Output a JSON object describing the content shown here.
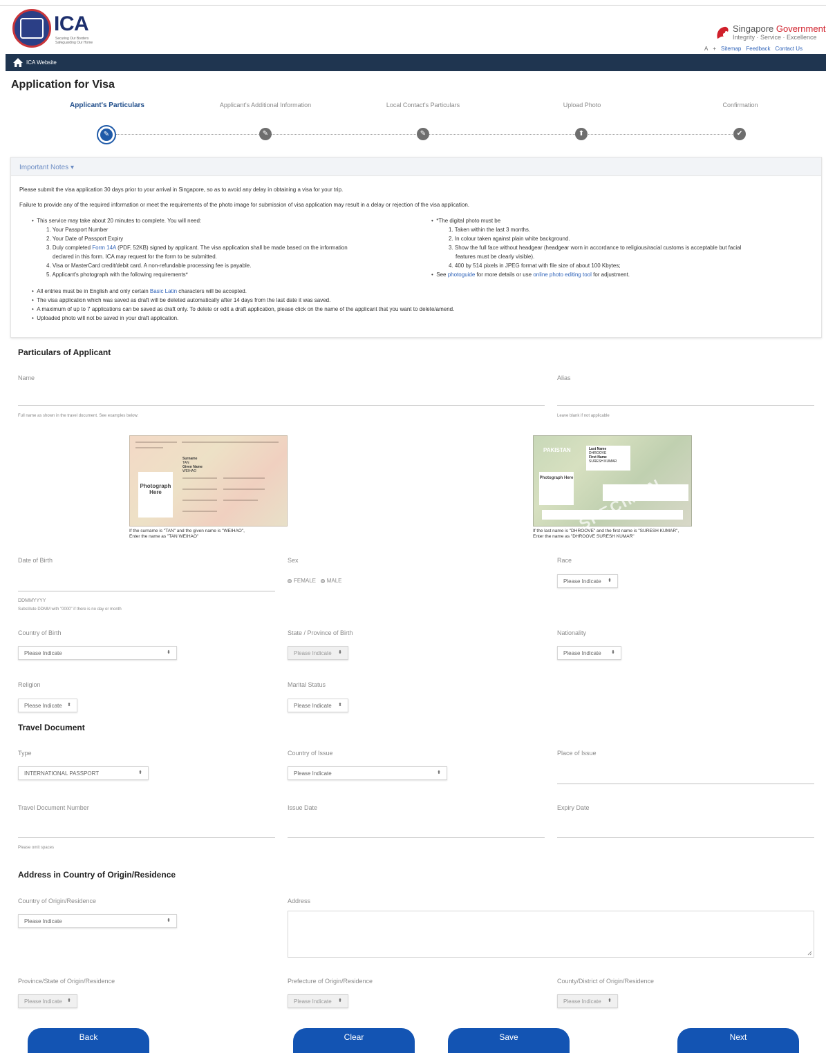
{
  "header": {
    "logo_text": "ICA",
    "logo_subtitle": "Securing Our Borders Safeguarding Our Home",
    "gov_name_part1": "Singapore",
    "gov_name_part2": "Government",
    "gov_motto": "Integrity · Service · Excellence",
    "font_small": "A",
    "font_large": "+",
    "sitemap": "Sitemap",
    "feedback": "Feedback",
    "contact": "Contact Us"
  },
  "nav": {
    "home_label": "ICA Website"
  },
  "page": {
    "title": "Application for Visa"
  },
  "steps": [
    {
      "label": "Applicant's Particulars"
    },
    {
      "label": "Applicant's Additional Information"
    },
    {
      "label": "Local Contact's Particulars"
    },
    {
      "label": "Upload Photo"
    },
    {
      "label": "Confirmation"
    }
  ],
  "notes": {
    "title": "Important Notes",
    "para1": "Please submit the visa application 30 days prior to your arrival in Singapore, so as to avoid any delay in obtaining a visa for your trip.",
    "para2": "Failure to provide any of the required information or meet the requirements of the photo image for submission of visa application may result in a delay or rejection of the visa application.",
    "need_intro": "This service may take about 20 minutes to complete. You will need:",
    "need_1": "1. Your Passport Number",
    "need_2": "2. Your Date of Passport Expiry",
    "need_3a": "3. Duly completed ",
    "need_3_link": "Form 14A",
    "need_3b": " (PDF, 52KB) signed by applicant. The visa application shall be made based on the information",
    "need_3c": "declared in this form. ICA may request for the form to be submitted.",
    "need_4": "4. Visa or MasterCard credit/debit card. A non-refundable processing fee is payable.",
    "need_5": "5. Applicant's photograph with the following requirements*",
    "photo_intro": "*The digital photo must be",
    "photo_1": "1. Taken within the last 3 months.",
    "photo_2": "2. In colour taken against plain white background.",
    "photo_3a": "3. Show the full face without headgear (headgear worn in accordance to religious/racial customs is acceptable but facial",
    "photo_3b": "features must be clearly visible).",
    "photo_4": "4. 400 by 514 pixels in JPEG format with file size of about 100 Kbytes;",
    "see_a": "See ",
    "see_link1": "photoguide",
    "see_b": " for more details or use ",
    "see_link2": "online photo editing tool",
    "see_c": " for adjustment.",
    "b1a": "All entries must be in English and only certain ",
    "b1_link": "Basic Latin",
    "b1b": " characters will be accepted.",
    "b2": "The visa application which was saved as draft will be deleted automatically after 14 days from the last date it was saved.",
    "b3": "A maximum of up to 7 applications can be saved as draft only. To delete or edit a draft application, please click on the name of the applicant that you want to delete/amend.",
    "b4": "Uploaded photo will not be saved in your draft application."
  },
  "particulars": {
    "section_title": "Particulars of Applicant",
    "name_label": "Name",
    "name_hint": "Full name as shown in the travel document. See examples below:",
    "alias_label": "Alias",
    "alias_hint": "Leave blank if not applicable",
    "example1": {
      "surname_label": "Surname",
      "surname": "TAN",
      "given_label": "Given Name",
      "given": "WEIHAO",
      "photo": "Photograph Here",
      "caption1": "If the surname is \"TAN\" and the given name is \"WEIHAO\",",
      "caption2": "Enter the name as \"TAN WEIHAO\""
    },
    "example2": {
      "country": "PAKISTAN",
      "last_label": "Last Name",
      "last": "DHROOVE",
      "first_label": "First Name",
      "first": "SURESH KUMAR",
      "photo": "Photograph Here",
      "specimen": "SPECIMEN",
      "caption1": "If the last name is \"DHROOVE\" and the first name is \"SURESH KUMAR\",",
      "caption2": "Enter the name as \"DHROOVE SURESH KUMAR\""
    },
    "dob_label": "Date of Birth",
    "dob_hint1": "DDMMYYYY",
    "dob_hint2": "Substitute DDMM with \"0000\" if there is no day or month",
    "sex_label": "Sex",
    "sex_female": "FEMALE",
    "sex_male": "MALE",
    "race_label": "Race",
    "race_value": "Please Indicate",
    "cob_label": "Country of Birth",
    "cob_value": "Please Indicate",
    "state_label": "State / Province of Birth",
    "state_value": "Please Indicate",
    "nationality_label": "Nationality",
    "nationality_value": "Please Indicate",
    "religion_label": "Religion",
    "religion_value": "Please Indicate",
    "marital_label": "Marital Status",
    "marital_value": "Please Indicate"
  },
  "travel": {
    "section_title": "Travel Document",
    "type_label": "Type",
    "type_value": "INTERNATIONAL PASSPORT",
    "coi_label": "Country of Issue",
    "coi_value": "Please Indicate",
    "poi_label": "Place of Issue",
    "tdn_label": "Travel Document Number",
    "tdn_hint": "Please omit spaces",
    "issue_label": "Issue Date",
    "expiry_label": "Expiry Date"
  },
  "address": {
    "section_title": "Address in Country of Origin/Residence",
    "country_label": "Country of Origin/Residence",
    "country_value": "Please Indicate",
    "address_label": "Address",
    "province_label": "Province/State of Origin/Residence",
    "province_value": "Please Indicate",
    "prefecture_label": "Prefecture of Origin/Residence",
    "prefecture_value": "Please Indicate",
    "county_label": "County/District of Origin/Residence",
    "county_value": "Please Indicate"
  },
  "buttons": {
    "back": "Back",
    "clear": "Clear",
    "save": "Save",
    "next": "Next"
  },
  "colors": {
    "primary": "#1354b3",
    "navbar": "#1f3550",
    "accent_red": "#d0202b"
  }
}
